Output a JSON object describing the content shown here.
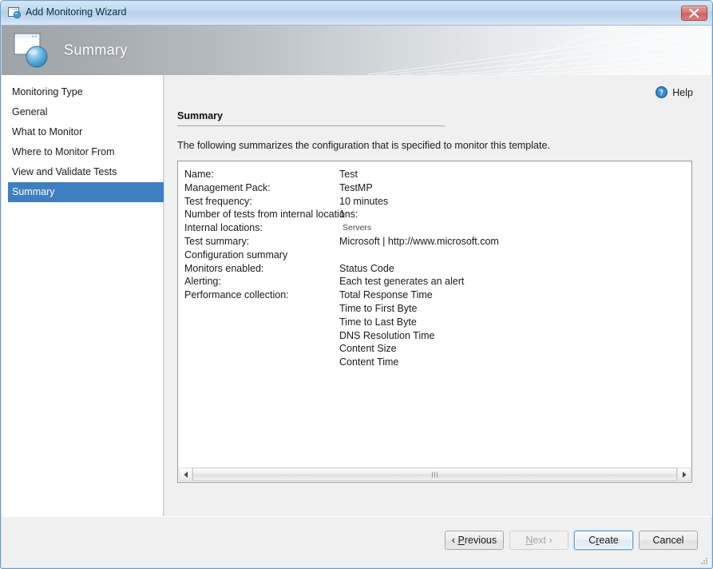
{
  "window": {
    "title": "Add Monitoring Wizard",
    "title_icon": "window-globe-icon",
    "close_label": "close-icon",
    "frame_color": "#6f9ec4"
  },
  "banner": {
    "title": "Summary",
    "icon": "window-globe-icon"
  },
  "sidebar": {
    "items": [
      {
        "label": "Monitoring Type",
        "selected": false
      },
      {
        "label": "General",
        "selected": false
      },
      {
        "label": "What to Monitor",
        "selected": false
      },
      {
        "label": "Where to Monitor From",
        "selected": false
      },
      {
        "label": "View and Validate Tests",
        "selected": false
      },
      {
        "label": "Summary",
        "selected": true
      }
    ],
    "selected_color": "#3f7fbf"
  },
  "content": {
    "help_label": "Help",
    "help_icon": "help-circle-icon",
    "section_title": "Summary",
    "intro_text": "The following summarizes the configuration that is specified to monitor this template.",
    "rows": [
      {
        "label": "Name:",
        "value": "Test",
        "small": false
      },
      {
        "label": "Management Pack:",
        "value": "TestMP",
        "small": false
      },
      {
        "label": "Test frequency:",
        "value": "10 minutes",
        "small": false
      },
      {
        "label": "Number of tests from internal locations:",
        "value": "1",
        "small": false
      },
      {
        "label": "Internal locations:",
        "value": "Servers",
        "small": true
      },
      {
        "label": "Test summary:",
        "value": "Microsoft | http://www.microsoft.com",
        "small": false
      },
      {
        "label": "Configuration summary",
        "value": "",
        "small": false
      },
      {
        "label": "Monitors enabled:",
        "value": "Status Code",
        "small": false
      },
      {
        "label": "Alerting:",
        "value": "Each test generates an alert",
        "small": false
      },
      {
        "label": "Performance collection:",
        "value": "Total Response Time",
        "small": false
      },
      {
        "label": "",
        "value": "Time to First Byte",
        "small": false
      },
      {
        "label": "",
        "value": "Time to Last Byte",
        "small": false
      },
      {
        "label": "",
        "value": "DNS Resolution Time",
        "small": false
      },
      {
        "label": "",
        "value": "Content Size",
        "small": false
      },
      {
        "label": "",
        "value": "Content Time",
        "small": false
      }
    ],
    "scrollbar": {
      "left_arrow": "scroll-left-arrow-icon",
      "right_arrow": "scroll-right-arrow-icon",
      "grip": "scroll-thumb-grip-icon"
    }
  },
  "footer": {
    "buttons": [
      {
        "label": "Previous",
        "prefix": "‹ ",
        "suffix": "",
        "accel": "P",
        "state": "enabled"
      },
      {
        "label": "Next",
        "prefix": "",
        "suffix": " ›",
        "accel": "N",
        "state": "disabled"
      },
      {
        "label": "Create",
        "prefix": "",
        "suffix": "",
        "accel": "r",
        "state": "default"
      },
      {
        "label": "Cancel",
        "prefix": "",
        "suffix": "",
        "accel": "",
        "state": "enabled"
      }
    ]
  }
}
